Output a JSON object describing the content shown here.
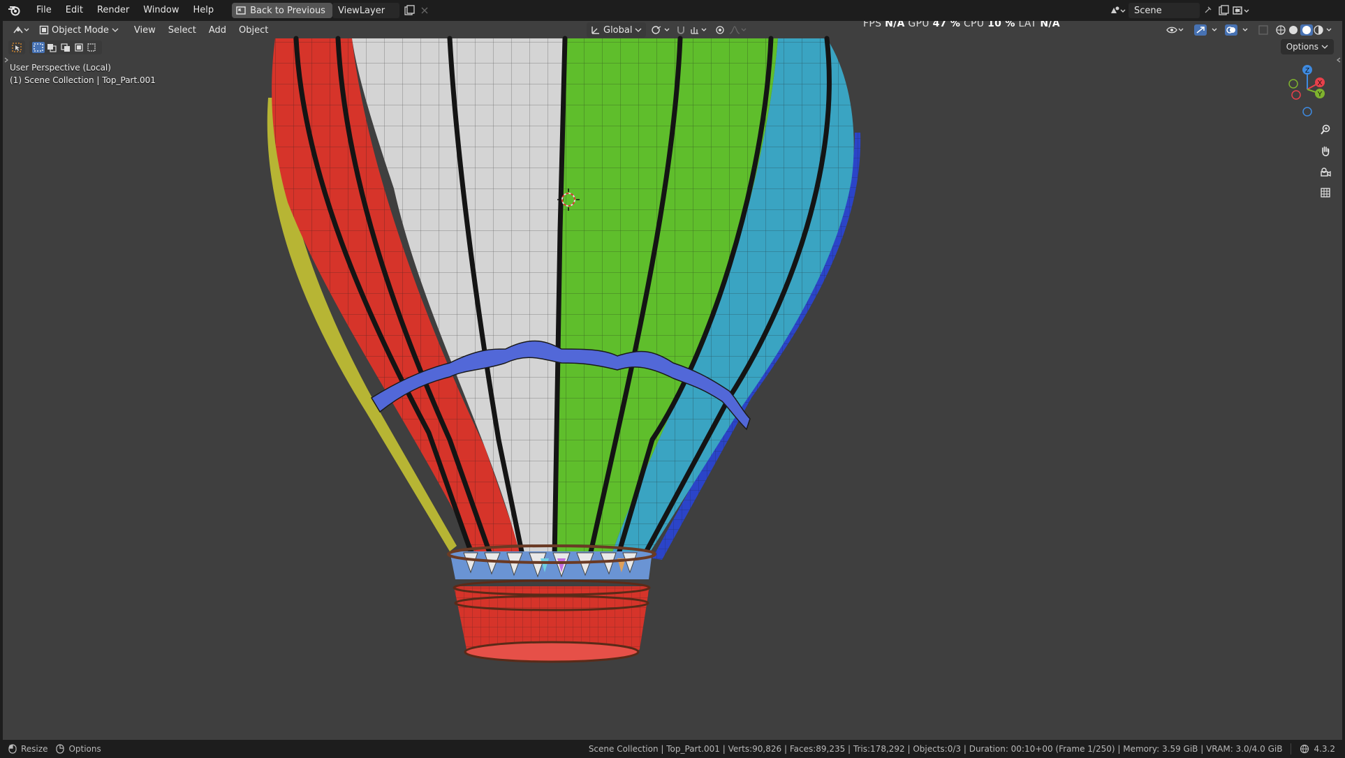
{
  "menu": {
    "items": [
      "File",
      "Edit",
      "Render",
      "Window",
      "Help"
    ],
    "back_label": "Back to Previous"
  },
  "scene": {
    "name": "Scene",
    "view_layer": "ViewLayer"
  },
  "viewport_header": {
    "mode": "Object Mode",
    "menus": [
      "View",
      "Select",
      "Add",
      "Object"
    ],
    "orientation": "Global",
    "options_label": "Options"
  },
  "overlay": {
    "perspective": "User Perspective (Local)",
    "collection": "(1) Scene Collection | Top_Part.001"
  },
  "stats": {
    "fps_label": "FPS",
    "fps": "N/A",
    "gpu_label": "GPU",
    "gpu": "47 %",
    "cpu_label": "CPU",
    "cpu": "10 %",
    "lat_label": "LAT",
    "lat": "N/A"
  },
  "gizmo": {
    "x": "X",
    "y": "Y",
    "z": "Z",
    "axis_colors": {
      "x": "#e8414b",
      "y": "#7fb32e",
      "z": "#3e8ae0"
    }
  },
  "status": {
    "resize": "Resize",
    "options": "Options",
    "info": "Scene Collection | Top_Part.001 | Verts:90,826 | Faces:89,235 | Tris:178,292 | Objects:0/3 | Duration: 00:10+00 (Frame 1/250) | Memory: 3.59 GiB | VRAM: 3.0/4.0 GiB",
    "version": "4.3.2"
  },
  "colors": {
    "viewport_bg": "#3f3f3f",
    "panel_red": "#d6342a",
    "panel_white": "#d4d4d4",
    "panel_green": "#5fbe2c",
    "panel_cyan": "#3aa4c2",
    "panel_blue": "#2b44c8",
    "panel_yellow": "#b7b534",
    "band_blue": "#5268d8"
  }
}
